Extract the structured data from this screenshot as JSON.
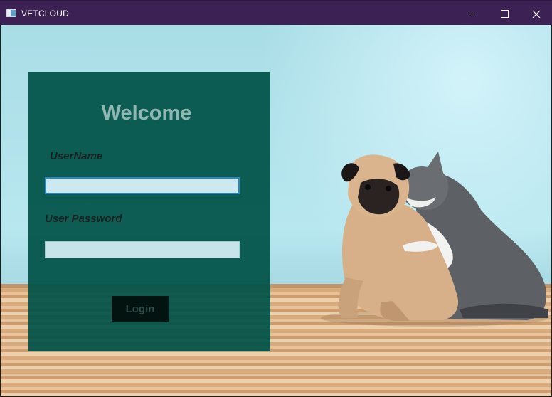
{
  "window": {
    "title": "VETCLOUD"
  },
  "login": {
    "heading": "Welcome",
    "username_label": "UserName",
    "username_value": "",
    "password_label": "User Password",
    "password_value": "",
    "login_button": "Login"
  },
  "colors": {
    "titlebar": "#3c2155",
    "panel": "#005248",
    "wall": "#b8e7ef",
    "floor": "#e0b88c"
  }
}
